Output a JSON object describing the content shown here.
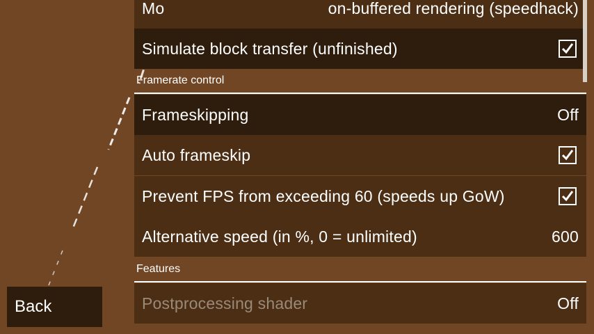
{
  "nav": {
    "back_label": "Back"
  },
  "rows_top": [
    {
      "label": "Mo",
      "value": "on-buffered rendering (speedhack)"
    },
    {
      "label": "Simulate block transfer (unfinished)",
      "checked": true
    }
  ],
  "sections": [
    {
      "title": "Framerate control",
      "items": [
        {
          "label": "Frameskipping",
          "value": "Off"
        },
        {
          "label": "Auto frameskip",
          "checked": true
        },
        {
          "label": "Prevent FPS from exceeding 60 (speeds up GoW)",
          "checked": true
        },
        {
          "label": "Alternative speed (in %, 0 = unlimited)",
          "value": "600"
        }
      ]
    },
    {
      "title": "Features",
      "items": [
        {
          "label": "Postprocessing shader",
          "value": "Off"
        }
      ]
    }
  ],
  "colors": {
    "background": "#714624",
    "row": "#4b2e14",
    "row_selected": "#2e1c0c",
    "disabled_text": "#9a8a7a"
  }
}
